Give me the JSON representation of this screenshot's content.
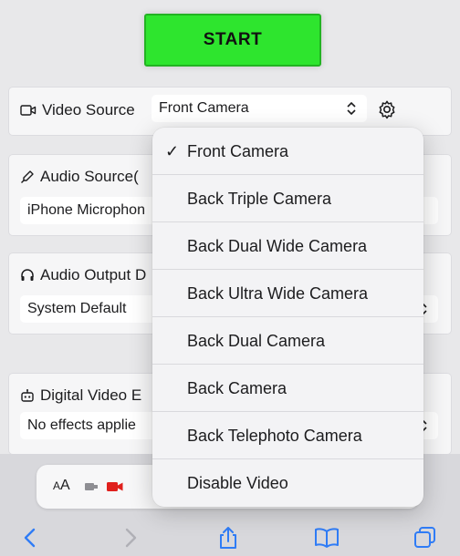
{
  "start_button": {
    "label": "START",
    "color": "#2ee52e"
  },
  "video_source": {
    "label": "Video Source",
    "selected": "Front Camera"
  },
  "audio_source": {
    "label": "Audio Source(",
    "value": "iPhone Microphon"
  },
  "audio_output": {
    "label": "Audio Output D",
    "value": "System Default"
  },
  "digital_video": {
    "label": "Digital Video E",
    "value": "No effects applie"
  },
  "dropdown": {
    "selected_mark": "✓",
    "options": [
      "Front Camera",
      "Back Triple Camera",
      "Back Dual Wide Camera",
      "Back Ultra Wide Camera",
      "Back Dual Camera",
      "Back Camera",
      "Back Telephoto Camera",
      "Disable Video"
    ]
  },
  "toolbar": {
    "text_size_label_big": "A",
    "text_size_label_small": "A"
  },
  "icons": {
    "video": "video-camera-icon",
    "mic": "microphone-icon",
    "headphones": "headphones-icon",
    "robot": "robot-icon",
    "gear": "gear-icon",
    "share": "share-icon",
    "bookmarks": "book-icon",
    "tabs": "tabs-icon"
  }
}
